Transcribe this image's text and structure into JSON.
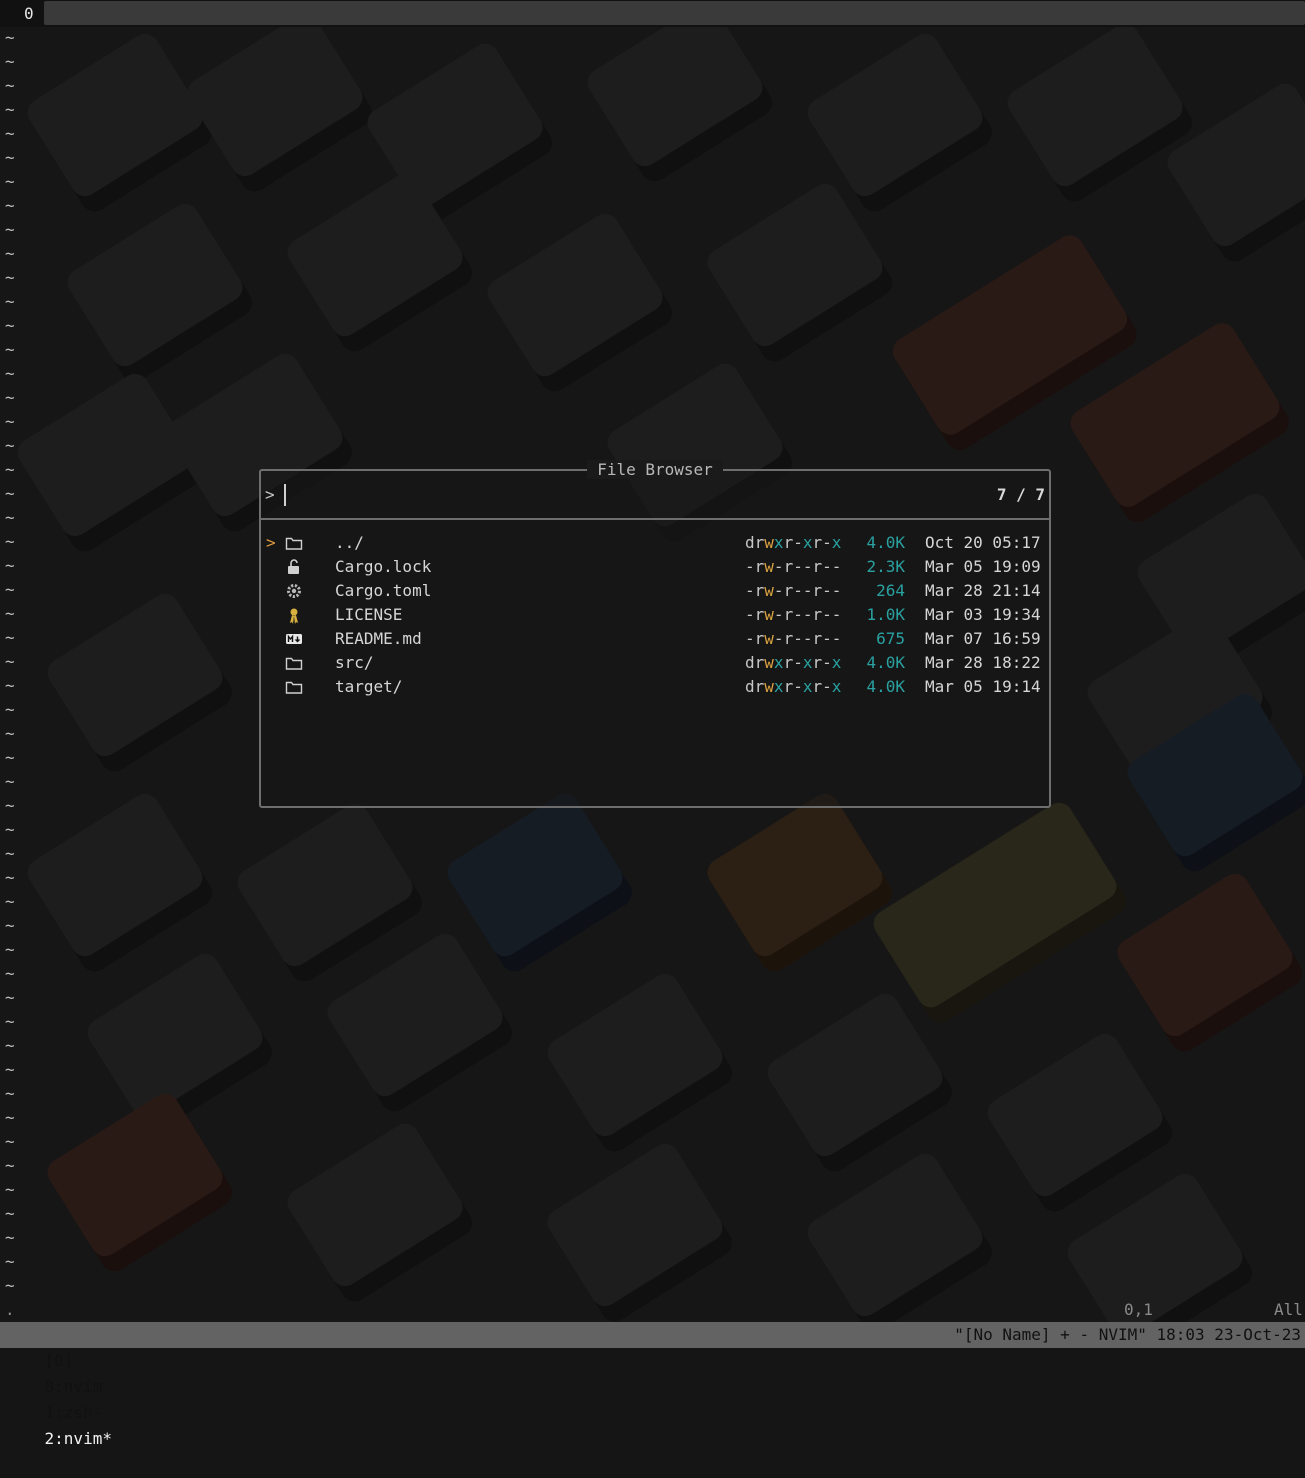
{
  "tmux_top": {
    "index": "0"
  },
  "popup": {
    "title": "File Browser",
    "prompt": ">",
    "count": "7 / 7",
    "selector": ">",
    "entries": [
      {
        "name": "../",
        "icon": "folder-icon",
        "perm": "drwxr-xr-x",
        "size": "4.0K",
        "date": "Oct 20 05:17"
      },
      {
        "name": "Cargo.lock",
        "icon": "lock-icon",
        "perm": "-rw-r--r--",
        "size": "2.3K",
        "date": "Mar 05 19:09"
      },
      {
        "name": "Cargo.toml",
        "icon": "gear-icon",
        "perm": "-rw-r--r--",
        "size": "264",
        "date": "Mar 28 21:14"
      },
      {
        "name": "LICENSE",
        "icon": "license-icon",
        "perm": "-rw-r--r--",
        "size": "1.0K",
        "date": "Mar 03 19:34"
      },
      {
        "name": "README.md",
        "icon": "markdown-icon",
        "perm": "-rw-r--r--",
        "size": "675",
        "date": "Mar 07 16:59"
      },
      {
        "name": "src/",
        "icon": "folder-icon",
        "perm": "drwxr-xr-x",
        "size": "4.0K",
        "date": "Mar 28 18:22"
      },
      {
        "name": "target/",
        "icon": "folder-icon",
        "perm": "drwxr-xr-x",
        "size": "4.0K",
        "date": "Mar 05 19:14"
      }
    ]
  },
  "editor": {
    "tilde": "~",
    "position": "0,1",
    "scroll": "All",
    "dot": "."
  },
  "statusbar": {
    "session": "[0]",
    "win0": "0:nvim",
    "win1": "1:zsh-",
    "win2": "2:nvim*",
    "right": "\"[No Name] + - NVIM\" 18:03 23-Oct-23"
  },
  "colors": {
    "selector": "#e09a3e",
    "size": "#2aa1a1",
    "perm_write": "#d8a040",
    "perm_exec": "#2aa1a1"
  }
}
